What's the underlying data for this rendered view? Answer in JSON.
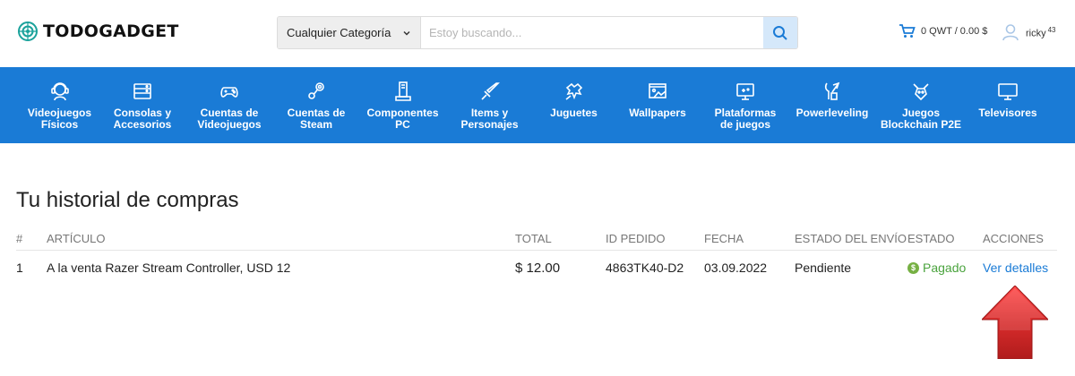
{
  "header": {
    "logo_text": "TODOGADGET",
    "search": {
      "category": "Cualquier Categoría",
      "placeholder": "Estoy buscando..."
    },
    "cart_text": "0 QWT / 0.00 $",
    "user_name": "ricky",
    "user_badge": "43"
  },
  "nav": {
    "items": [
      {
        "label": "Videojuegos\nFísicos",
        "icon": "gamer-icon"
      },
      {
        "label": "Consolas y\nAccesorios",
        "icon": "console-icon"
      },
      {
        "label": "Cuentas de\nVideojuegos",
        "icon": "gamepad-icon"
      },
      {
        "label": "Cuentas de\nSteam",
        "icon": "steam-icon"
      },
      {
        "label": "Componentes\nPC",
        "icon": "pc-components-icon"
      },
      {
        "label": "Items y\nPersonajes",
        "icon": "sword-icon"
      },
      {
        "label": "Juguetes",
        "icon": "toys-icon"
      },
      {
        "label": "Wallpapers",
        "icon": "wallpaper-icon"
      },
      {
        "label": "Plataformas\nde juegos",
        "icon": "platform-icon"
      },
      {
        "label": "Powerleveling",
        "icon": "powerleveling-icon"
      },
      {
        "label": "Juegos\nBlockchain P2E",
        "icon": "blockchain-icon"
      },
      {
        "label": "Televisores",
        "icon": "tv-icon"
      }
    ]
  },
  "main": {
    "title": "Tu historial de compras",
    "table": {
      "columns": [
        "#",
        "ARTÍCULO",
        "TOTAL",
        "ID PEDIDO",
        "FECHA",
        "ESTADO DEL ENVÍO",
        "ESTADO",
        "ACCIONES"
      ],
      "rows": [
        {
          "num": "1",
          "article": "A la venta Razer Stream Controller, USD 12",
          "total": "$ 12.00",
          "order_id": "4863TK40-D2",
          "date": "03.09.2022",
          "shipping": "Pendiente",
          "status": "Pagado",
          "status_symbol": "$",
          "action": "Ver detalles"
        }
      ]
    }
  },
  "colors": {
    "brand_blue": "#1a7bd6",
    "status_green": "#4aa33d",
    "arrow_red": "#d42a2a"
  }
}
